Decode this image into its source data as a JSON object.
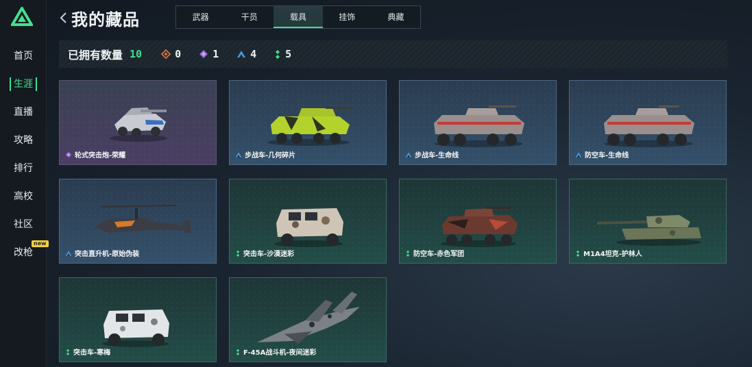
{
  "sidebar": {
    "items": [
      {
        "label": "首页"
      },
      {
        "label": "生涯"
      },
      {
        "label": "直播"
      },
      {
        "label": "攻略"
      },
      {
        "label": "排行"
      },
      {
        "label": "高校"
      },
      {
        "label": "社区"
      },
      {
        "label": "改枪",
        "badge": "new"
      }
    ],
    "active_index": 1
  },
  "header": {
    "title": "我的藏品",
    "tabs": [
      {
        "label": "武器"
      },
      {
        "label": "干员"
      },
      {
        "label": "载具"
      },
      {
        "label": "挂饰"
      },
      {
        "label": "典藏"
      }
    ],
    "active_tab": 2
  },
  "summary": {
    "label": "已拥有数量",
    "count": "10",
    "rarities": [
      {
        "icon": "orange-diamond-icon",
        "color": "#e0783a",
        "count": "0"
      },
      {
        "icon": "purple-diamond-icon",
        "color": "#9a6ad8",
        "count": "1"
      },
      {
        "icon": "blue-triangle-icon",
        "color": "#4a9ae0",
        "count": "4"
      },
      {
        "icon": "green-dots-icon",
        "color": "#3ee28f",
        "count": "5"
      }
    ]
  },
  "cards": [
    {
      "name": "轮式突击炮-荣耀",
      "rarity": "purple"
    },
    {
      "name": "步战车-几何碎片",
      "rarity": "blue"
    },
    {
      "name": "步战车-生命线",
      "rarity": "blue"
    },
    {
      "name": "防空车-生命线",
      "rarity": "blue"
    },
    {
      "name": "突击直升机-原始伪装",
      "rarity": "blue"
    },
    {
      "name": "突击车-沙漠迷彩",
      "rarity": "green"
    },
    {
      "name": "防空车-赤色军团",
      "rarity": "green"
    },
    {
      "name": "M1A4坦克-护林人",
      "rarity": "green"
    },
    {
      "name": "突击车-寒梅",
      "rarity": "green"
    },
    {
      "name": "F-45A战斗机-夜间迷彩",
      "rarity": "green"
    }
  ],
  "colors": {
    "accent": "#3ee28f",
    "badge": "#f5d23a"
  }
}
